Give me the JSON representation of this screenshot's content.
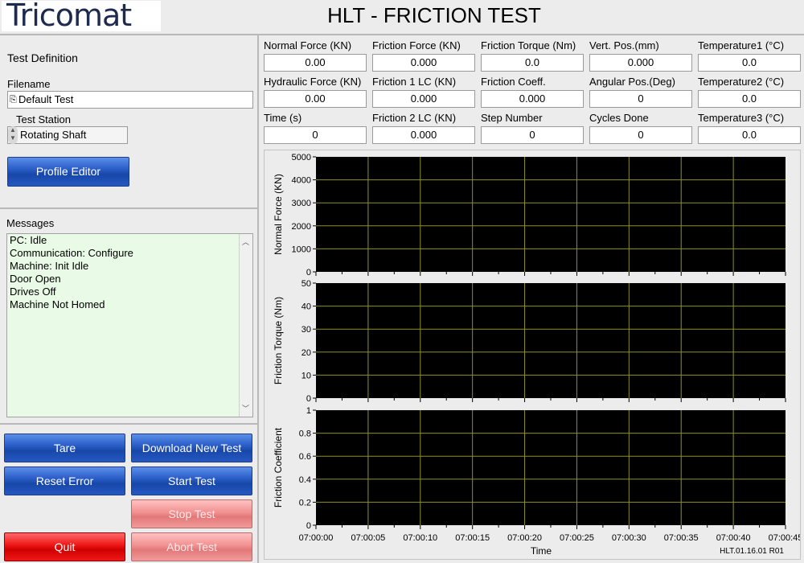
{
  "header": {
    "logo_text": "Tricomat",
    "title": "HLT - FRICTION TEST"
  },
  "test_definition": {
    "heading": "Test Definition",
    "filename_label": "Filename",
    "filename_value": "Default Test",
    "station_label": "Test Station",
    "station_value": "Rotating Shaft",
    "profile_editor_label": "Profile Editor"
  },
  "messages": {
    "heading": "Messages",
    "lines": [
      "PC: Idle",
      "Communication: Configure",
      "Machine: Init Idle",
      "Door Open",
      "Drives Off",
      "Machine Not Homed"
    ]
  },
  "buttons": {
    "tare": "Tare",
    "download": "Download New Test",
    "reset": "Reset Error",
    "start": "Start Test",
    "stop": "Stop Test",
    "quit": "Quit",
    "abort": "Abort Test"
  },
  "readouts": [
    {
      "label": "Normal Force (KN)",
      "value": "0.00"
    },
    {
      "label": "Friction Force (KN)",
      "value": "0.000"
    },
    {
      "label": "Friction Torque (Nm)",
      "value": "0.0"
    },
    {
      "label": "Vert. Pos.(mm)",
      "value": "0.000"
    },
    {
      "label": "Temperature1 (°C)",
      "value": "0.0"
    },
    {
      "label": "Hydraulic Force (KN)",
      "value": "0.00"
    },
    {
      "label": "Friction 1 LC (KN)",
      "value": "0.000"
    },
    {
      "label": "Friction Coeff.",
      "value": "0.000"
    },
    {
      "label": "Angular Pos.(Deg)",
      "value": "0"
    },
    {
      "label": "Temperature2 (°C)",
      "value": "0.0"
    },
    {
      "label": "Time (s)",
      "value": "0"
    },
    {
      "label": "Friction 2 LC (KN)",
      "value": "0.000"
    },
    {
      "label": "Step Number",
      "value": "0"
    },
    {
      "label": "Cycles Done",
      "value": "0"
    },
    {
      "label": "Temperature3 (°C)",
      "value": "0.0"
    }
  ],
  "chart_data": [
    {
      "type": "line",
      "ylabel": "Normal Force (KN)",
      "ylim": [
        0,
        5000
      ],
      "yticks": [
        "0",
        "1000",
        "2000",
        "3000",
        "4000",
        "5000"
      ],
      "series": [],
      "grid": true,
      "background": "#000000",
      "grid_color": "#8f8f2a"
    },
    {
      "type": "line",
      "ylabel": "Friction Torque (Nm)",
      "ylim": [
        0,
        50
      ],
      "yticks": [
        "0",
        "10",
        "20",
        "30",
        "40",
        "50"
      ],
      "series": [],
      "grid": true,
      "background": "#000000",
      "grid_color": "#8f8f2a"
    },
    {
      "type": "line",
      "ylabel": "Friction Coefficient",
      "ylim": [
        0,
        1
      ],
      "yticks": [
        "0",
        "0.2",
        "0.4",
        "0.6",
        "0.8",
        "1"
      ],
      "series": [],
      "grid": true,
      "background": "#000000",
      "grid_color": "#8f8f2a",
      "xlabel": "Time",
      "xticks": [
        "07:00:00",
        "07:00:05",
        "07:00:10",
        "07:00:15",
        "07:00:20",
        "07:00:25",
        "07:00:30",
        "07:00:35",
        "07:00:40",
        "07:00:45"
      ]
    }
  ],
  "footer": {
    "version": "HLT.01.16.01 R01"
  }
}
